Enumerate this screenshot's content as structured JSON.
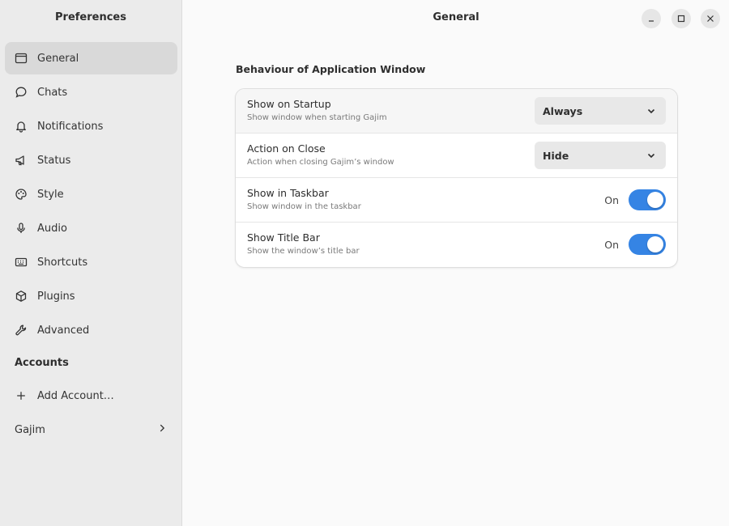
{
  "sidebar": {
    "title": "Preferences",
    "items": [
      {
        "label": "General",
        "icon": "window-icon",
        "active": true
      },
      {
        "label": "Chats",
        "icon": "chat-bubble-icon",
        "active": false
      },
      {
        "label": "Notifications",
        "icon": "bell-icon",
        "active": false
      },
      {
        "label": "Status",
        "icon": "megaphone-icon",
        "active": false
      },
      {
        "label": "Style",
        "icon": "palette-icon",
        "active": false
      },
      {
        "label": "Audio",
        "icon": "microphone-icon",
        "active": false
      },
      {
        "label": "Shortcuts",
        "icon": "keyboard-icon",
        "active": false
      },
      {
        "label": "Plugins",
        "icon": "package-icon",
        "active": false
      },
      {
        "label": "Advanced",
        "icon": "wrench-icon",
        "active": false
      }
    ],
    "accounts_heading": "Accounts",
    "add_account_label": "Add Account…",
    "account_name": "Gajim"
  },
  "main": {
    "title": "General",
    "group_title": "Behaviour of Application Window",
    "rows": [
      {
        "title": "Show on Startup",
        "subtitle": "Show window when starting Gajim",
        "control": "dropdown",
        "value": "Always"
      },
      {
        "title": "Action on Close",
        "subtitle": "Action when closing Gajim’s window",
        "control": "dropdown",
        "value": "Hide"
      },
      {
        "title": "Show in Taskbar",
        "subtitle": "Show window in the taskbar",
        "control": "switch",
        "state_label": "On"
      },
      {
        "title": "Show Title Bar",
        "subtitle": "Show the window’s title bar",
        "control": "switch",
        "state_label": "On"
      }
    ]
  },
  "colors": {
    "accent": "#3584e4",
    "sidebar_bg": "#ebebeb",
    "main_bg": "#fafafa"
  }
}
